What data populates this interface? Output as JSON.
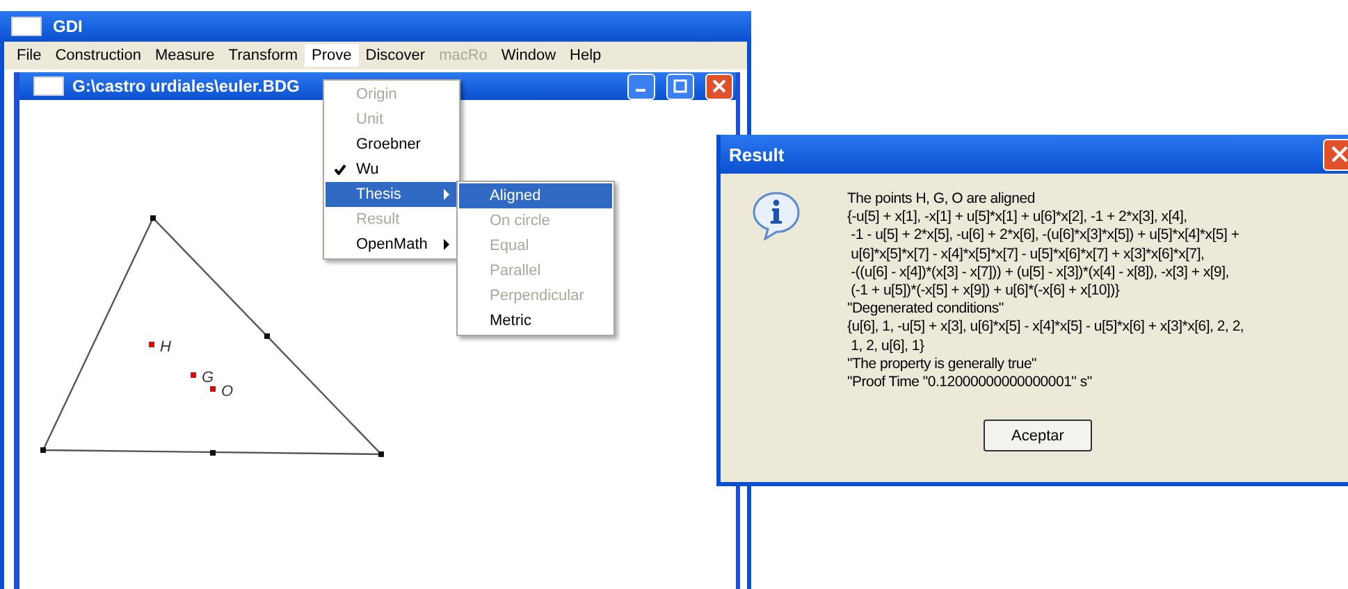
{
  "app_window": {
    "title": "GDI"
  },
  "menu_bar": [
    {
      "label": "File",
      "selected": false,
      "disabled": false
    },
    {
      "label": "Construction",
      "selected": false,
      "disabled": false
    },
    {
      "label": "Measure",
      "selected": false,
      "disabled": false
    },
    {
      "label": "Transform",
      "selected": false,
      "disabled": false
    },
    {
      "label": "Prove",
      "selected": true,
      "disabled": false
    },
    {
      "label": "Discover",
      "selected": false,
      "disabled": false
    },
    {
      "label": "macRo",
      "selected": false,
      "disabled": true
    },
    {
      "label": "Window",
      "selected": false,
      "disabled": false
    },
    {
      "label": "Help",
      "selected": false,
      "disabled": false
    }
  ],
  "document_window": {
    "title": "G:\\castro urdiales\\euler.BDG"
  },
  "prove_menu": [
    {
      "label": "Origin",
      "disabled": true,
      "checked": false,
      "selected": false,
      "submenu": false
    },
    {
      "label": "Unit",
      "disabled": true,
      "checked": false,
      "selected": false,
      "submenu": false
    },
    {
      "label": "Groebner",
      "disabled": false,
      "checked": false,
      "selected": false,
      "submenu": false
    },
    {
      "label": "Wu",
      "disabled": false,
      "checked": true,
      "selected": false,
      "submenu": false
    },
    {
      "label": "Thesis",
      "disabled": false,
      "checked": false,
      "selected": true,
      "submenu": true
    },
    {
      "label": "Result",
      "disabled": true,
      "checked": false,
      "selected": false,
      "submenu": false
    },
    {
      "label": "OpenMath",
      "disabled": false,
      "checked": false,
      "selected": false,
      "submenu": true
    }
  ],
  "thesis_submenu": [
    {
      "label": "Aligned",
      "disabled": false,
      "selected": true
    },
    {
      "label": "On circle",
      "disabled": true,
      "selected": false
    },
    {
      "label": "Equal",
      "disabled": true,
      "selected": false
    },
    {
      "label": "Parallel",
      "disabled": true,
      "selected": false
    },
    {
      "label": "Perpendicular",
      "disabled": true,
      "selected": false
    },
    {
      "label": "Metric",
      "disabled": false,
      "selected": false
    }
  ],
  "canvas": {
    "points": [
      {
        "label": "H"
      },
      {
        "label": "G"
      },
      {
        "label": "O"
      }
    ]
  },
  "result_dialog": {
    "title": "Result",
    "lines": [
      "The points H, G, O are aligned",
      "{-u[5] + x[1], -x[1] + u[5]*x[1] + u[6]*x[2], -1 + 2*x[3], x[4],",
      " -1 - u[5] + 2*x[5], -u[6] + 2*x[6], -(u[6]*x[3]*x[5]) + u[5]*x[4]*x[5] +",
      " u[6]*x[5]*x[7] - x[4]*x[5]*x[7] - u[5]*x[6]*x[7] + x[3]*x[6]*x[7],",
      " -((u[6] - x[4])*(x[3] - x[7])) + (u[5] - x[3])*(x[4] - x[8]), -x[3] + x[9],",
      " (-1 + u[5])*(-x[5] + x[9]) + u[6]*(-x[6] + x[10])}",
      "\"Degenerated conditions\"",
      "{u[6], 1, -u[5] + x[3], u[6]*x[5] - x[4]*x[5] - u[5]*x[6] + x[3]*x[6], 2, 2,",
      " 1, 2, u[6], 1}",
      "\"The property is generally true\"",
      "\"Proof Time \"0.12000000000000001\" s\""
    ],
    "button": "Aceptar"
  }
}
